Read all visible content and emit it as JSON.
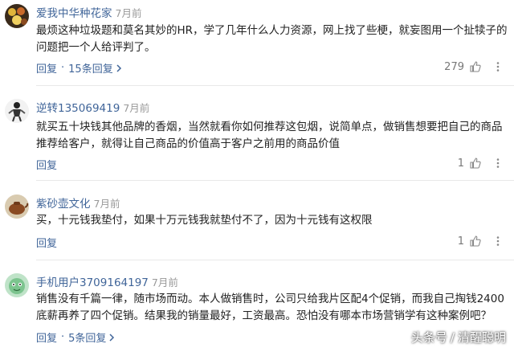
{
  "comments": [
    {
      "user": "爱我中华种花家",
      "time": "7月前",
      "text": "最烦这种垃圾题和莫名其妙的HR，学了几年什么人力资源，网上找了些梗，就妄图用一个扯犊子的问题把一个人给评判了。",
      "reply": "回复",
      "sep": "·",
      "replies": "15条回复",
      "likes": "279",
      "avatar_icon": "flowers-avatar"
    },
    {
      "user": "逆转135069419",
      "time": "7月前",
      "text": "就买五十块钱其他品牌的香烟，当然就看你如何推荐这包烟，说简单点，做销售想要把自己的商品推荐给客户，就得让自己商品的价值高于客户之前用的商品价值",
      "reply": "回复",
      "likes": "1",
      "avatar_icon": "figure-avatar"
    },
    {
      "user": "紫砂壶文化",
      "time": "7月前",
      "text": "买，十元钱我垫付，如果十万元钱我就垫付不了，因为十元钱有这权限",
      "reply": "回复",
      "likes": "1",
      "avatar_icon": "teapot-avatar"
    },
    {
      "user": "手机用户3709164197",
      "time": "7月前",
      "text": "销售没有千篇一律，随市场而动。本人做销售时，公司只给我片区配4个促销，而我自己掏钱2400底薪再养了四个促销。结果我的销量最好，工资最高。恐怕没有哪本市场营销学有这种案例吧？",
      "reply": "回复",
      "sep": "·",
      "replies": "5条回复",
      "avatar_icon": "mascot-avatar"
    }
  ],
  "watermark": {
    "brand": "头条号",
    "sep": "/",
    "author": "清醒聪明"
  }
}
